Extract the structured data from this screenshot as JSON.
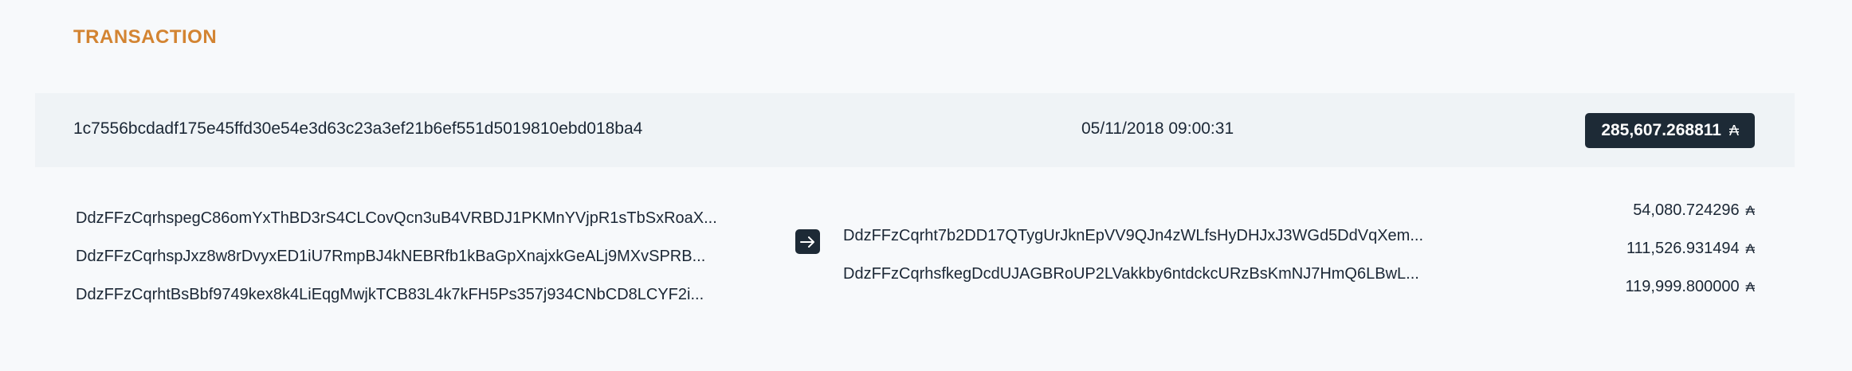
{
  "section": {
    "title": "TRANSACTION"
  },
  "transaction": {
    "hash": "1c7556bcdadf175e45ffd30e54e3d63c23a3ef21b6ef551d5019810ebd018ba4",
    "datetime": "05/11/2018 09:00:31",
    "total_amount": "285,607.268811",
    "currency_symbol": "₳"
  },
  "inputs": [
    {
      "address": "DdzFFzCqrhspegC86omYxThBD3rS4CLCovQcn3uB4VRBDJ1PKMnYVjpR1sTbSxRoaX..."
    },
    {
      "address": "DdzFFzCqrhspJxz8w8rDvyxED1iU7RmpBJ4kNEBRfb1kBaGpXnajxkGeALj9MXvSPRB..."
    },
    {
      "address": "DdzFFzCqrhtBsBbf9749kex8k4LiEqgMwjkTCB83L4k7kFH5Ps357j934CNbCD8LCYF2i..."
    }
  ],
  "outputs": [
    {
      "address": "DdzFFzCqrht7b2DD17QTygUrJknEpVV9QJn4zWLfsHyDHJxJ3WGd5DdVqXem..."
    },
    {
      "address": "DdzFFzCqrhsfkegDcdUJAGBRoUP2LVakkby6ntdckcURzBsKmNJ7HmQ6LBwL..."
    }
  ],
  "amounts": [
    {
      "value": "54,080.724296",
      "currency_symbol": "₳"
    },
    {
      "value": "111,526.931494",
      "currency_symbol": "₳"
    },
    {
      "value": "119,999.800000",
      "currency_symbol": "₳"
    }
  ],
  "icons": {
    "arrow": "arrow-right-icon"
  },
  "colors": {
    "accent": "#d38432",
    "badge_bg": "#1d2a36",
    "header_bg": "#eff3f6",
    "page_bg": "#f7f9fb"
  }
}
